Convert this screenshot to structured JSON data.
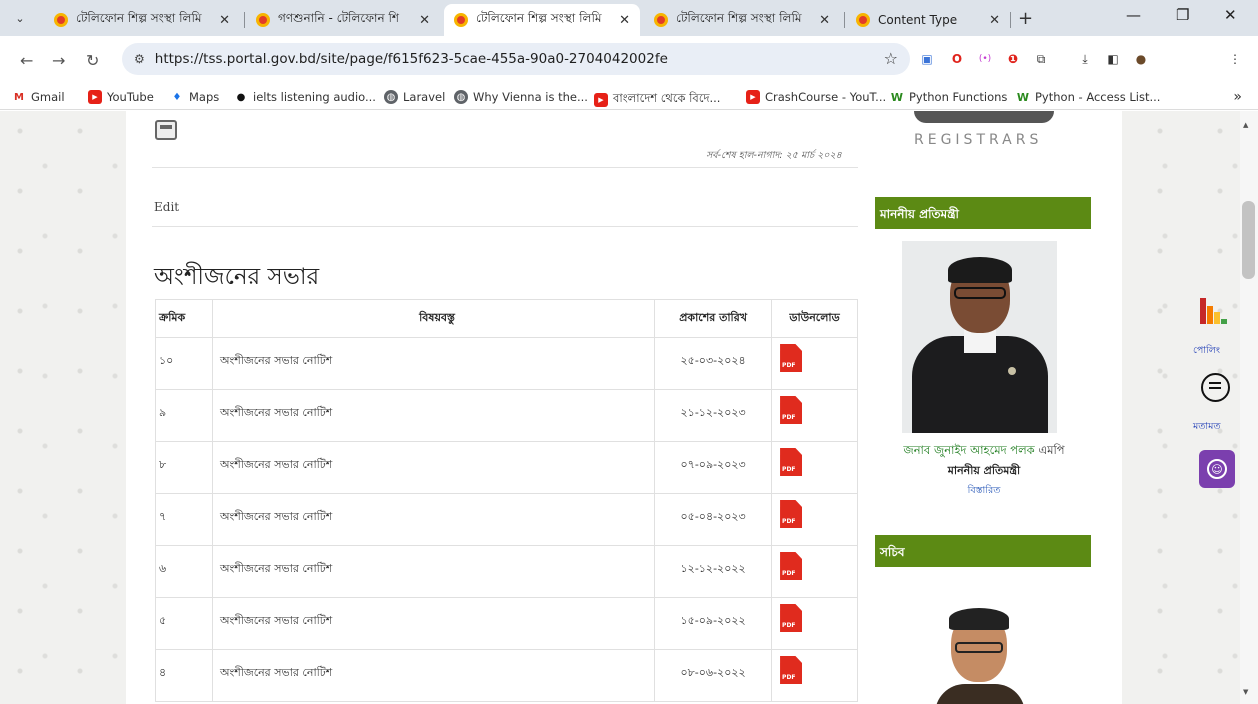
{
  "browser": {
    "tabs": [
      {
        "title": "টেলিফোন শিল্প সংস্থা লিমি",
        "close": "✕"
      },
      {
        "title": "গণশুনানি - টেলিফোন শি",
        "close": "✕"
      },
      {
        "title": "টেলিফোন শিল্প সংস্থা লিমি",
        "close": "✕"
      },
      {
        "title": "টেলিফোন শিল্প সংস্থা লিমি",
        "close": "✕"
      },
      {
        "title": "Content Type",
        "close": "✕"
      }
    ],
    "url": "https://tss.portal.gov.bd/site/page/f615f623-5cae-455a-90a0-2704042002fe",
    "bookmarks": [
      "Gmail",
      "YouTube",
      "Maps",
      "ielts listening audio...",
      "Laravel",
      "Why Vienna is the...",
      "বাংলাদেশ থেকে বিদে...",
      "CrashCourse - YouT...",
      "Python Functions",
      "Python - Access List..."
    ]
  },
  "page": {
    "updated": "সর্ব-শেষ হাল-নাগাদ: ২৫ মার্চ ২০২৪",
    "edit": "Edit",
    "title": "অংশীজনের সভার",
    "table": {
      "headers": [
        "ক্রমিক",
        "বিষয়বস্তু",
        "প্রকাশের তারিখ",
        "ডাউনলোড"
      ],
      "rows": [
        {
          "serial": "১০",
          "subject": "অংশীজনের সভার নোটিশ",
          "date": "২৫-০৩-২০২৪"
        },
        {
          "serial": "৯",
          "subject": "অংশীজনের সভার নোটিশ",
          "date": "২১-১২-২০২৩"
        },
        {
          "serial": "৮",
          "subject": "অংশীজনের সভার নোটিশ",
          "date": "০৭-০৯-২০২৩"
        },
        {
          "serial": "৭",
          "subject": "অংশীজনের সভার নোটিশ",
          "date": "০৫-০৪-২০২৩"
        },
        {
          "serial": "৬",
          "subject": "অংশীজনের সভার নোটিশ",
          "date": "১২-১২-২০২২"
        },
        {
          "serial": "৫",
          "subject": "অংশীজনের সভার নোটিশ",
          "date": "১৫-০৯-২০২২"
        },
        {
          "serial": "৪",
          "subject": "অংশীজনের সভার নোটিশ",
          "date": "০৮-০৬-২০২২"
        }
      ],
      "pdf_label": "PDF"
    }
  },
  "sidebar": {
    "registrars": "REGISTRARS",
    "minister_heading": "মাননীয় প্রতিমন্ত্রী",
    "minister_name": "জনাব জুনাইদ আহমেদ পলক",
    "minister_suffix": "এমপি",
    "minister_title": "মাননীয় প্রতিমন্ত্রী",
    "minister_more": "বিস্তারিত",
    "secretary_heading": "সচিব"
  },
  "widgets": {
    "poll_label": "পোলিং",
    "feedback_label": "মতামত"
  },
  "colors": {
    "sidebar_green": "#5c8a14",
    "pdf_red": "#e02b1e",
    "accessibility_purple": "#7b3fae"
  }
}
